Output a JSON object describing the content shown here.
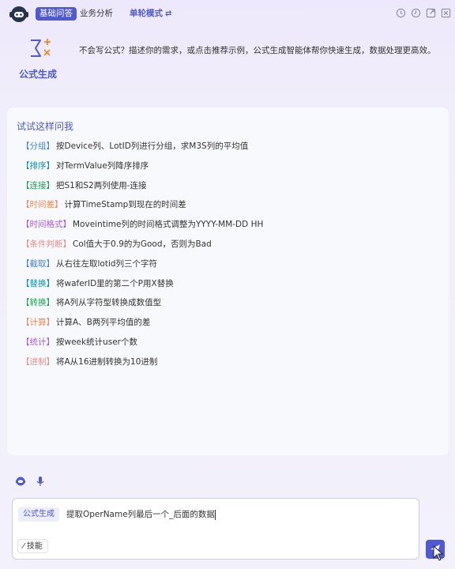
{
  "header": {
    "tabs": [
      {
        "label": "基础问答",
        "active": true
      },
      {
        "label": "业务分析",
        "active": false
      }
    ],
    "mode_label": "单轮模式",
    "mode_switch_glyph": "⇄",
    "window_icons": [
      "history-icon",
      "clock-icon",
      "popout-icon",
      "close-icon"
    ]
  },
  "intro": {
    "title": "公式生成",
    "description": "不会写公式？描述你的需求，或点击推荐示例，公式生成智能体帮你快速生成，数据处理更高效。"
  },
  "suggestions": {
    "title": "试试这样问我",
    "items": [
      {
        "tag": "【分组】",
        "text": "按Device列、LotID列进行分组，求M3S列的平均值",
        "color": "#3b82f6"
      },
      {
        "tag": "【排序】",
        "text": "对TermValue列降序排序",
        "color": "#0891b2"
      },
      {
        "tag": "【连接】",
        "text": "把S1和S2两列使用-连接",
        "color": "#16a34a"
      },
      {
        "tag": "【时间差】",
        "text": "计算TimeStamp到现在的时间差",
        "color": "#ea8a5a"
      },
      {
        "tag": "【时间格式】",
        "text": "Moveintime列的时间格式调整为YYYY-MM-DD HH",
        "color": "#a855f7"
      },
      {
        "tag": "【条件判断】",
        "text": "Col值大于0.9的为Good，否则为Bad",
        "color": "#f08b8b"
      },
      {
        "tag": "【截取】",
        "text": "从右往左取lotid列三个字符",
        "color": "#3b82f6"
      },
      {
        "tag": "【替换】",
        "text": "将waferID里的第二个P用X替换",
        "color": "#0891b2"
      },
      {
        "tag": "【转换】",
        "text": "将A列从字符型转换成数值型",
        "color": "#16a34a"
      },
      {
        "tag": "【计算】",
        "text": "计算A、B两列平均值的差",
        "color": "#ea8a5a"
      },
      {
        "tag": "【统计】",
        "text": "按week统计user个数",
        "color": "#a855f7"
      },
      {
        "tag": "【进制】",
        "text": "将A从16进制转换为10进制",
        "color": "#f08b8b"
      }
    ]
  },
  "composer": {
    "chip_label": "公式生成",
    "value": "提取OperName列最后一个_后面的数据",
    "skill_label": "技能"
  },
  "colors": {
    "accent": "#4f59d6",
    "card_bg": "#f8f9fc"
  }
}
